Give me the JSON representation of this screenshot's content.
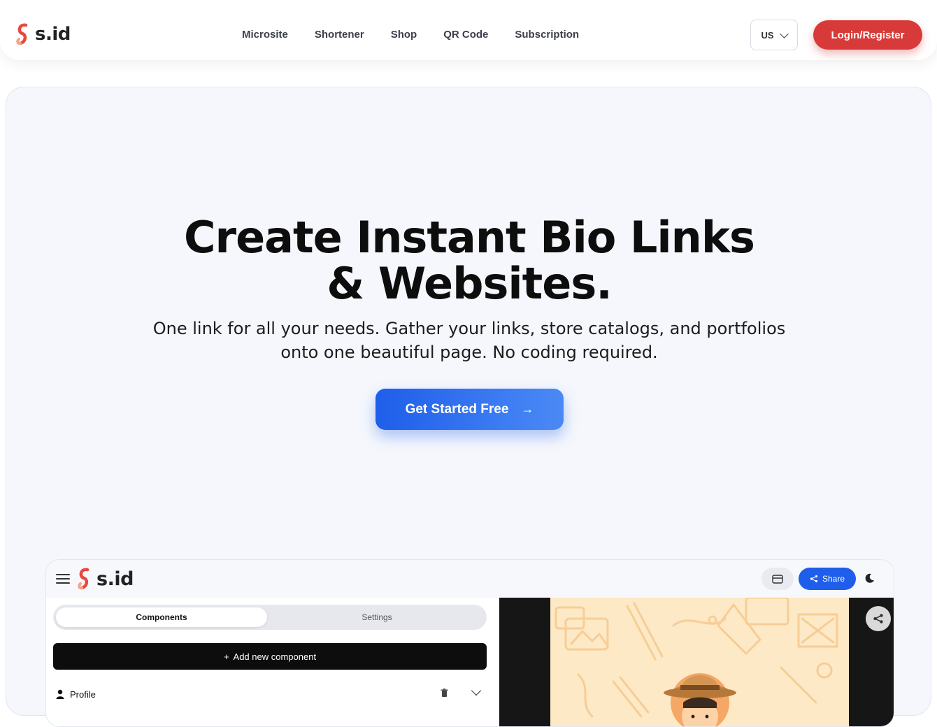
{
  "header": {
    "logo_text": "s.id",
    "nav": [
      "Microsite",
      "Shortener",
      "Shop",
      "QR Code",
      "Subscription"
    ],
    "language": "US",
    "login_label": "Login/Register"
  },
  "hero": {
    "title_line1": "Create Instant Bio Links",
    "title_line2": "& Websites.",
    "subtitle_line1": "One link for all your needs. Gather your links, store catalogs, and portfolios",
    "subtitle_line2": "onto one beautiful page. No coding required.",
    "cta_label": "Get Started Free"
  },
  "app_preview": {
    "logo_text": "s.id",
    "share_label": "Share",
    "tabs": [
      "Components",
      "Settings"
    ],
    "add_component_label": "Add new component",
    "profile_label": "Profile"
  },
  "colors": {
    "brand_red": "#d83a3a",
    "primary_blue": "#1e5eea"
  }
}
